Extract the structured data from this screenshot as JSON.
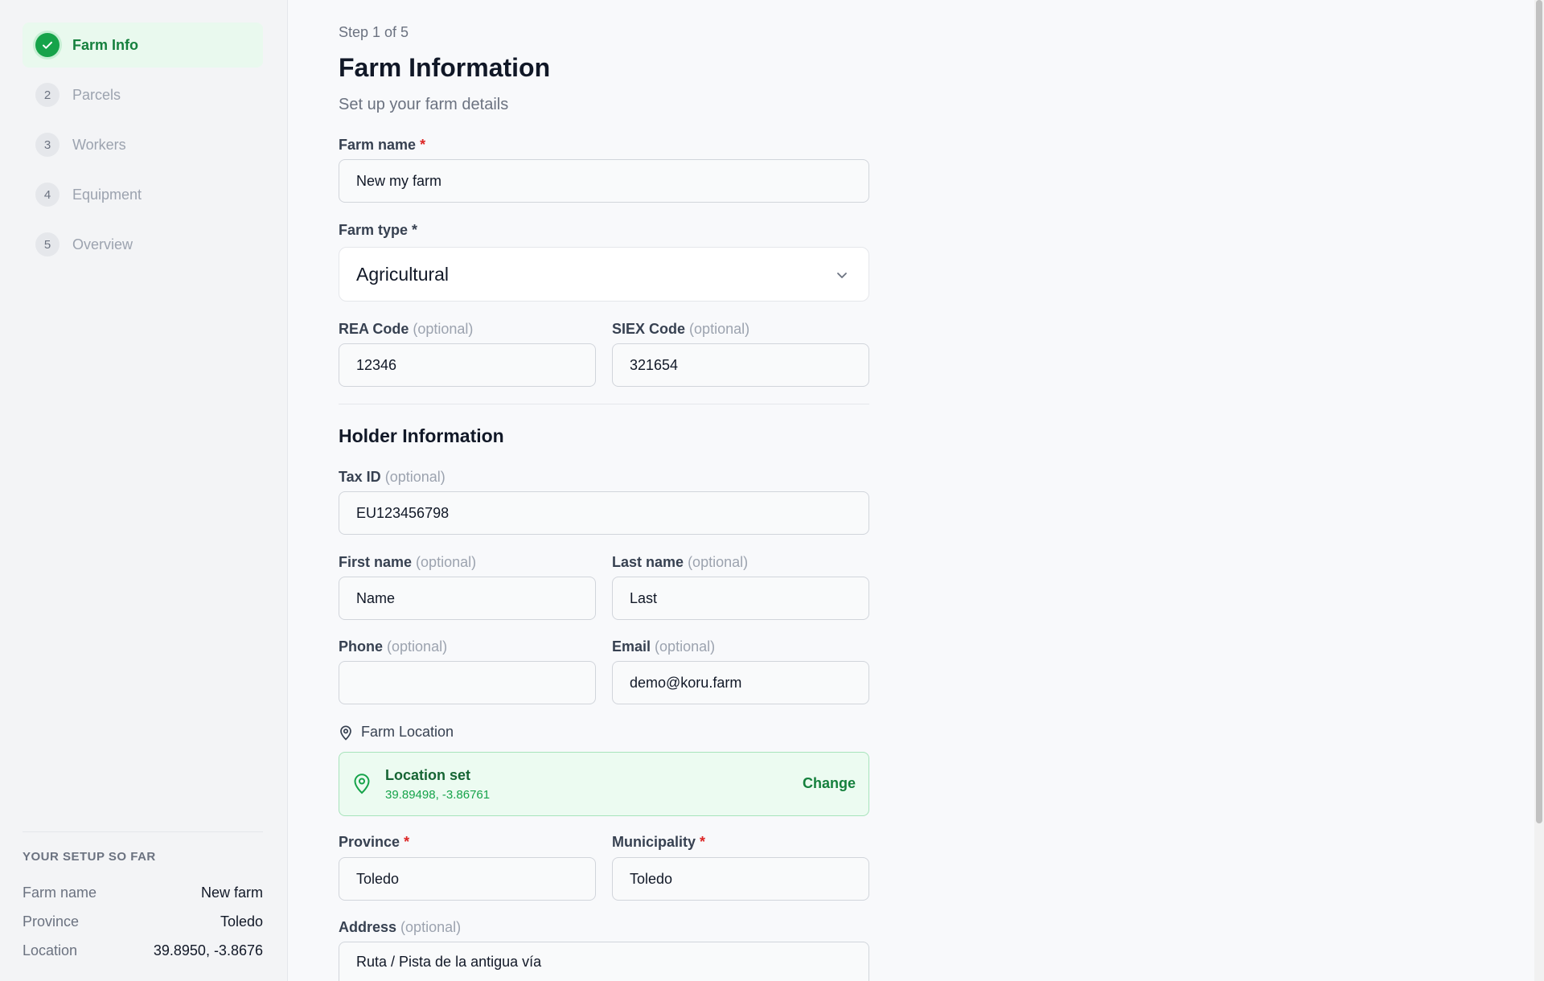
{
  "sidebar": {
    "steps": [
      {
        "number": "1",
        "label": "Farm Info",
        "active": true
      },
      {
        "number": "2",
        "label": "Parcels"
      },
      {
        "number": "3",
        "label": "Workers"
      },
      {
        "number": "4",
        "label": "Equipment"
      },
      {
        "number": "5",
        "label": "Overview"
      }
    ],
    "summary": {
      "title": "YOUR SETUP SO FAR",
      "rows": [
        {
          "key": "Farm name",
          "value": "New farm"
        },
        {
          "key": "Province",
          "value": "Toledo"
        },
        {
          "key": "Location",
          "value": "39.8950, -3.8676"
        }
      ]
    }
  },
  "header": {
    "step_count": "Step 1 of 5",
    "title": "Farm Information",
    "subtitle": "Set up your farm details"
  },
  "form": {
    "farm_name": {
      "label": "Farm name",
      "required_mark": "*",
      "value": "New my farm"
    },
    "farm_type": {
      "label": "Farm type",
      "required_mark": "*",
      "value": "Agricultural"
    },
    "rea_code": {
      "label": "REA Code",
      "optional": "(optional)",
      "value": "12346"
    },
    "siex_code": {
      "label": "SIEX Code",
      "optional": "(optional)",
      "value": "321654"
    },
    "holder_title": "Holder Information",
    "tax_id": {
      "label": "Tax ID",
      "optional": "(optional)",
      "value": "EU123456798"
    },
    "first_name": {
      "label": "First name",
      "optional": "(optional)",
      "value": "Name"
    },
    "last_name": {
      "label": "Last name",
      "optional": "(optional)",
      "value": "Last"
    },
    "phone": {
      "label": "Phone",
      "optional": "(optional)",
      "value": ""
    },
    "email": {
      "label": "Email",
      "optional": "(optional)",
      "value": "demo@koru.farm"
    },
    "location": {
      "label": "Farm Location",
      "status": "Location set",
      "coords": "39.89498, -3.86761",
      "change": "Change"
    },
    "province": {
      "label": "Province",
      "required_mark": "*",
      "value": "Toledo"
    },
    "municipality": {
      "label": "Municipality",
      "required_mark": "*",
      "value": "Toledo"
    },
    "address": {
      "label": "Address",
      "optional": "(optional)",
      "value": "Ruta / Pista de la antigua vía"
    }
  },
  "colors": {
    "accent": "#16a34a",
    "required": "#dc2626"
  }
}
